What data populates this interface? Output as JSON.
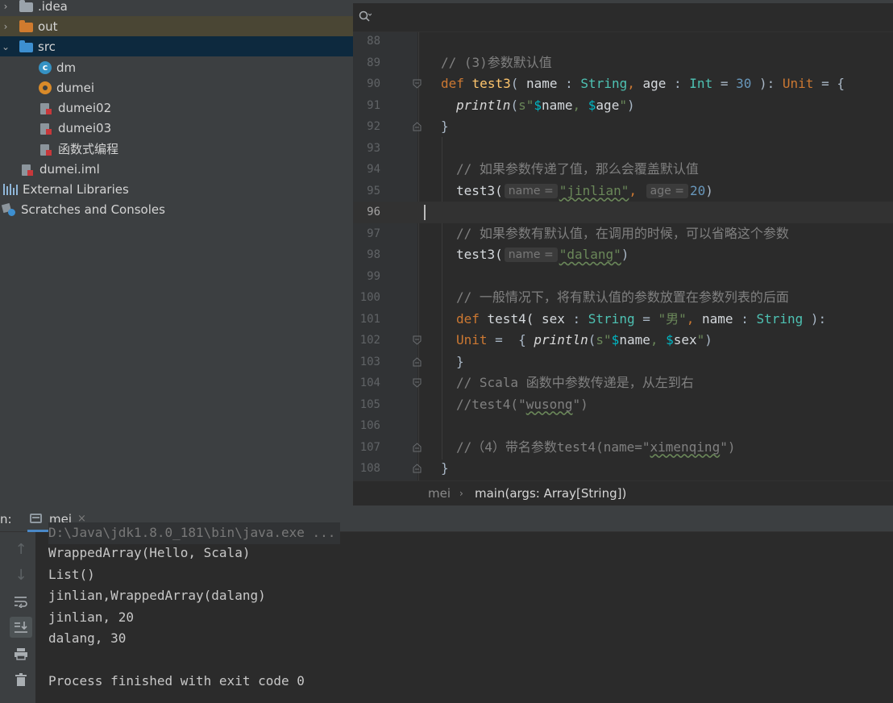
{
  "project_tree": [
    {
      "label": ".idea",
      "icon": "folder-icon",
      "chevron": "›"
    },
    {
      "label": "out",
      "icon": "folder-icon",
      "chevron": "›"
    },
    {
      "label": "src",
      "icon": "folder-icon",
      "chevron": "⌄"
    },
    {
      "label": "dm",
      "icon": "scala-object-icon",
      "glyph": "c"
    },
    {
      "label": "dumei",
      "icon": "scala-object-icon"
    },
    {
      "label": "dumei02",
      "icon": "scala-file-icon"
    },
    {
      "label": "dumei03",
      "icon": "scala-file-icon"
    },
    {
      "label": "函数式编程",
      "icon": "scala-file-icon"
    },
    {
      "label": "dumei.iml",
      "icon": "module-file-icon"
    },
    {
      "label": "External Libraries",
      "icon": "library-icon"
    },
    {
      "label": "Scratches and Consoles",
      "icon": "scratches-icon"
    }
  ],
  "editor": {
    "line_numbers": [
      "88",
      "89",
      "90",
      "91",
      "92",
      "93",
      "94",
      "95",
      "96",
      "97",
      "98",
      "99",
      "100",
      "101",
      "102",
      "103",
      "104",
      "105",
      "106",
      "107",
      "108"
    ],
    "code": {
      "l89": "// (3)参数默认值",
      "l90": {
        "def": "def",
        "name": "test3",
        "a": "( ",
        "p1": "name",
        "c1": " : ",
        "t1": "String",
        "comma1": ", ",
        "p2": "age",
        "c2": " : ",
        "t2": "Int",
        "eq": " = ",
        "n1": "30",
        "close": " ): ",
        "ret": "Unit",
        "tail": " = {"
      },
      "l91": {
        "fn": "println",
        "open": "(",
        "s": "s\"",
        "d1": "$",
        "v1": "name",
        "comma": ", ",
        "d2": "$",
        "v2": "age",
        "q": "\"",
        "close": ")"
      },
      "l92": "}",
      "l94": "// 如果参数传递了值，那么会覆盖默认值",
      "l95": {
        "call": "test3(",
        "hint1": "name =",
        "s1": "\"jinlian\"",
        "comma": ",",
        "hint2": "age =",
        "n": "20",
        "close": ")"
      },
      "l97": "// 如果参数有默认值，在调用的时候，可以省略这个参数",
      "l98": {
        "call": "test3(",
        "hint1": "name =",
        "s1": "\"dalang\"",
        "close": ")"
      },
      "l100": "// 一般情况下，将有默认值的参数放置在参数列表的后面",
      "l101": {
        "def": "def",
        "name": " test4( ",
        "p1": "sex",
        "c1": " : ",
        "t1": "String",
        "eq": " = ",
        "s1": "\"男\"",
        "comma": ", ",
        "p2": "name",
        "c2": " : ",
        "t2": "String",
        "close": " ):"
      },
      "l102": {
        "ret": "Unit",
        "eq": " =  { ",
        "fn": "println",
        "open": "(",
        "s": "s\"",
        "d1": "$",
        "v1": "name",
        "comma": ", ",
        "d2": "$",
        "v2": "sex",
        "q": "\"",
        "close": ")"
      },
      "l103": "}",
      "l104": "// Scala 函数中参数传递是，从左到右",
      "l105a": "//test4(\"",
      "l105b": "wusong",
      "l105c": "\")",
      "l107a": "//（4）带名参数test4(name=\"",
      "l107b": "ximenqing",
      "l107c": "\")",
      "l108": "}"
    }
  },
  "breadcrumb": {
    "item1": "mei",
    "separator": "›",
    "item2": "main(args: Array[String])"
  },
  "run_panel": {
    "label": "n:",
    "tab_label": "mei",
    "tab_close": "×",
    "output": [
      "D:\\Java\\jdk1.8.0_181\\bin\\java.exe ...",
      "WrappedArray(Hello, Scala)",
      "List()",
      "jinlian,WrappedArray(dalang)",
      "jinlian, 20",
      "dalang, 30",
      "",
      "Process finished with exit code 0"
    ],
    "side_icons": [
      "arrow-up-icon",
      "arrow-down-icon",
      "soft-wrap-icon",
      "scroll-to-end-icon",
      "print-icon",
      "trash-icon"
    ]
  },
  "colors": {
    "keyword": "#cc7832",
    "function": "#ffc66d",
    "type": "#4ec2b3",
    "number": "#6897bb",
    "string": "#6a8759",
    "comment": "#808080",
    "selection": "#0d293e",
    "accent": "#4a88c7"
  }
}
